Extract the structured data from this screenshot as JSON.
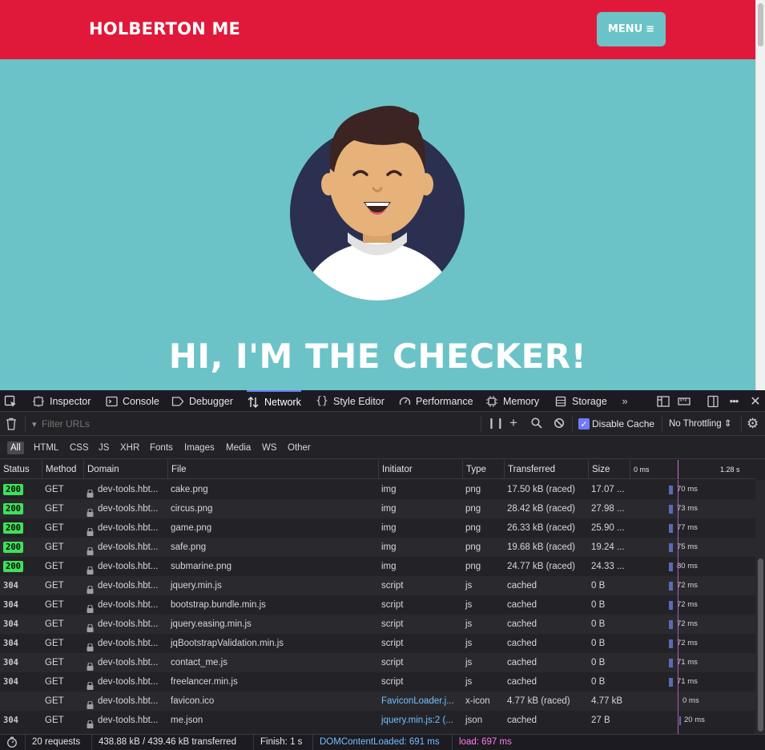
{
  "site": {
    "brand": "HOLBERTON ME",
    "menu_label": "MENU",
    "hero_heading": "HI, I'M THE CHECKER!",
    "colors": {
      "nav": "#e0193a",
      "hero": "#6bc3c8"
    }
  },
  "devtools": {
    "tabs": [
      {
        "label": "Inspector",
        "icon": "inspector-icon"
      },
      {
        "label": "Console",
        "icon": "console-icon"
      },
      {
        "label": "Debugger",
        "icon": "debugger-icon"
      },
      {
        "label": "Network",
        "icon": "network-icon",
        "selected": true
      },
      {
        "label": "Style Editor",
        "icon": "style-editor-icon"
      },
      {
        "label": "Performance",
        "icon": "performance-icon"
      },
      {
        "label": "Memory",
        "icon": "memory-icon"
      },
      {
        "label": "Storage",
        "icon": "storage-icon"
      }
    ],
    "filter_placeholder": "Filter URLs",
    "disable_cache_label": "Disable Cache",
    "disable_cache_checked": true,
    "throttling_label": "No Throttling",
    "type_filters": [
      "All",
      "HTML",
      "CSS",
      "JS",
      "XHR",
      "Fonts",
      "Images",
      "Media",
      "WS",
      "Other"
    ],
    "columns": {
      "status": "Status",
      "method": "Method",
      "domain": "Domain",
      "file": "File",
      "initiator": "Initiator",
      "type": "Type",
      "transferred": "Transferred",
      "size": "Size",
      "waterfall_start": "0 ms",
      "waterfall_end": "1.28 s"
    },
    "requests": [
      {
        "status": "200",
        "method": "GET",
        "domain": "dev-tools.hbt...",
        "file": "cake.png",
        "initiator": "img",
        "type": "png",
        "transferred": "17.50 kB (raced)",
        "size": "17.07 ...",
        "timing": "70 ms"
      },
      {
        "status": "200",
        "method": "GET",
        "domain": "dev-tools.hbt...",
        "file": "circus.png",
        "initiator": "img",
        "type": "png",
        "transferred": "28.42 kB (raced)",
        "size": "27.98 ...",
        "timing": "73 ms"
      },
      {
        "status": "200",
        "method": "GET",
        "domain": "dev-tools.hbt...",
        "file": "game.png",
        "initiator": "img",
        "type": "png",
        "transferred": "26.33 kB (raced)",
        "size": "25.90 ...",
        "timing": "77 ms"
      },
      {
        "status": "200",
        "method": "GET",
        "domain": "dev-tools.hbt...",
        "file": "safe.png",
        "initiator": "img",
        "type": "png",
        "transferred": "19.68 kB (raced)",
        "size": "19.24 ...",
        "timing": "75 ms"
      },
      {
        "status": "200",
        "method": "GET",
        "domain": "dev-tools.hbt...",
        "file": "submarine.png",
        "initiator": "img",
        "type": "png",
        "transferred": "24.77 kB (raced)",
        "size": "24.33 ...",
        "timing": "80 ms"
      },
      {
        "status": "304",
        "method": "GET",
        "domain": "dev-tools.hbt...",
        "file": "jquery.min.js",
        "initiator": "script",
        "type": "js",
        "transferred": "cached",
        "size": "0 B",
        "timing": "72 ms"
      },
      {
        "status": "304",
        "method": "GET",
        "domain": "dev-tools.hbt...",
        "file": "bootstrap.bundle.min.js",
        "initiator": "script",
        "type": "js",
        "transferred": "cached",
        "size": "0 B",
        "timing": "72 ms"
      },
      {
        "status": "304",
        "method": "GET",
        "domain": "dev-tools.hbt...",
        "file": "jquery.easing.min.js",
        "initiator": "script",
        "type": "js",
        "transferred": "cached",
        "size": "0 B",
        "timing": "72 ms"
      },
      {
        "status": "304",
        "method": "GET",
        "domain": "dev-tools.hbt...",
        "file": "jqBootstrapValidation.min.js",
        "initiator": "script",
        "type": "js",
        "transferred": "cached",
        "size": "0 B",
        "timing": "72 ms"
      },
      {
        "status": "304",
        "method": "GET",
        "domain": "dev-tools.hbt...",
        "file": "contact_me.js",
        "initiator": "script",
        "type": "js",
        "transferred": "cached",
        "size": "0 B",
        "timing": "71 ms"
      },
      {
        "status": "304",
        "method": "GET",
        "domain": "dev-tools.hbt...",
        "file": "freelancer.min.js",
        "initiator": "script",
        "type": "js",
        "transferred": "cached",
        "size": "0 B",
        "timing": "71 ms"
      },
      {
        "status": "",
        "method": "GET",
        "domain": "dev-tools.hbt...",
        "file": "favicon.ico",
        "initiator": "FaviconLoader.j...",
        "type": "x-icon",
        "transferred": "4.77 kB (raced)",
        "size": "4.77 kB",
        "timing": "0 ms"
      },
      {
        "status": "304",
        "method": "GET",
        "domain": "dev-tools.hbt...",
        "file": "me.json",
        "initiator": "jquery.min.js:2 (...",
        "type": "json",
        "transferred": "cached",
        "size": "27 B",
        "timing": "20 ms"
      }
    ],
    "summary": {
      "requests": "20 requests",
      "transferred": "438.88 kB / 439.46 kB transferred",
      "finish": "Finish: 1 s",
      "dom_content_loaded": "DOMContentLoaded: 691 ms",
      "load": "load: 697 ms"
    }
  }
}
